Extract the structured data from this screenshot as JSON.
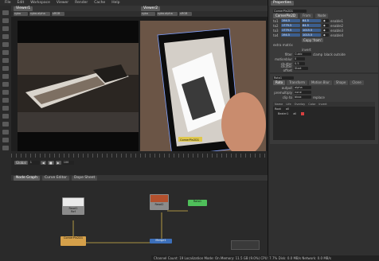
{
  "menubar": {
    "items": [
      "File",
      "Edit",
      "Workspace",
      "Viewer",
      "Render",
      "Cache",
      "Help"
    ]
  },
  "viewer1": {
    "tab": "Viewer1",
    "layer_select": "rgba",
    "channel_select": "rgba.alpha",
    "colorspace": "sRGB"
  },
  "viewer2": {
    "tab": "Viewer2",
    "layer_select": "rgba",
    "channel_select": "rgba.alpha",
    "colorspace": "sRGB",
    "overlay_label": "CornerPin2D1"
  },
  "timeline": {
    "frame_label": "Global",
    "frame_value": "1",
    "end_value": "100"
  },
  "nodegraph": {
    "tabs": [
      "Node Graph",
      "Curve Editor",
      "Dope Sheet"
    ],
    "nodes": {
      "read1": "Read1",
      "read1_sub": "Ref",
      "read2": "Read2",
      "cornerpin": "CornerPin2D1",
      "merge": "Merge1",
      "blur": "Blur1",
      "viewer": "Viewer1"
    }
  },
  "properties": {
    "title": "Properties",
    "node1_name": "CornerPin2D1",
    "node1_tabs": [
      "CornerPin2D",
      "From",
      "Node"
    ],
    "pin_rows": [
      {
        "label": "to1",
        "x": "194.5",
        "y": "64.5",
        "enable": "enable1"
      },
      {
        "label": "to2",
        "x": "1779.5",
        "y": "64.5",
        "enable": "enable2"
      },
      {
        "label": "to3",
        "x": "1779.5",
        "y": "1015.5",
        "enable": "enable3"
      },
      {
        "label": "to4",
        "x": "194.5",
        "y": "1015.5",
        "enable": "enable4"
      }
    ],
    "copy_from": "Copy 'from'",
    "extra_matrix": "extra matrix",
    "invert": "invert",
    "filter_label": "filter",
    "filter_value": "Cubic",
    "clamp": "clamp",
    "black_outside": "black outside",
    "motionblur_label": "motionblur",
    "motionblur_value": "0",
    "shutter_label": "shutter",
    "shutter_value": "0.5",
    "shutter_offset_label": "shutter offset",
    "shutter_offset_value": "Start",
    "node2_name": "Roto1",
    "node2_tabs": [
      "Roto",
      "Transform",
      "Motion Blur",
      "Shape",
      "Clone",
      "Lifetime",
      "Node"
    ],
    "output_label": "output",
    "output_value": "alpha",
    "premult_label": "premultiply",
    "premult_value": "none",
    "clip_label": "clip to",
    "clip_value": "bbox",
    "replace": "replace",
    "layers_header": [
      "Name",
      "Life",
      "Overlay",
      "Color",
      "Invert",
      "Blending mode",
      "Motion blur"
    ],
    "layers": [
      {
        "name": "Root",
        "life": "all"
      },
      {
        "name": "Bezier1",
        "life": "all"
      }
    ]
  },
  "status": {
    "text": "Channel Count: 19 Localization Mode: On Memory: 11.5 GB (9.0%) CPU: 7.7% Disk: 0.0 MB/s Network: 0.0 MB/s"
  },
  "colors": {
    "accent_blue": "#3c5e8e",
    "read_node": "#8b8b8b",
    "cornerpin_node": "#d5a04a",
    "merge_node": "#3c6fba",
    "roto_node": "#4fbf5a",
    "viewer_node": "#a0a0a0"
  }
}
